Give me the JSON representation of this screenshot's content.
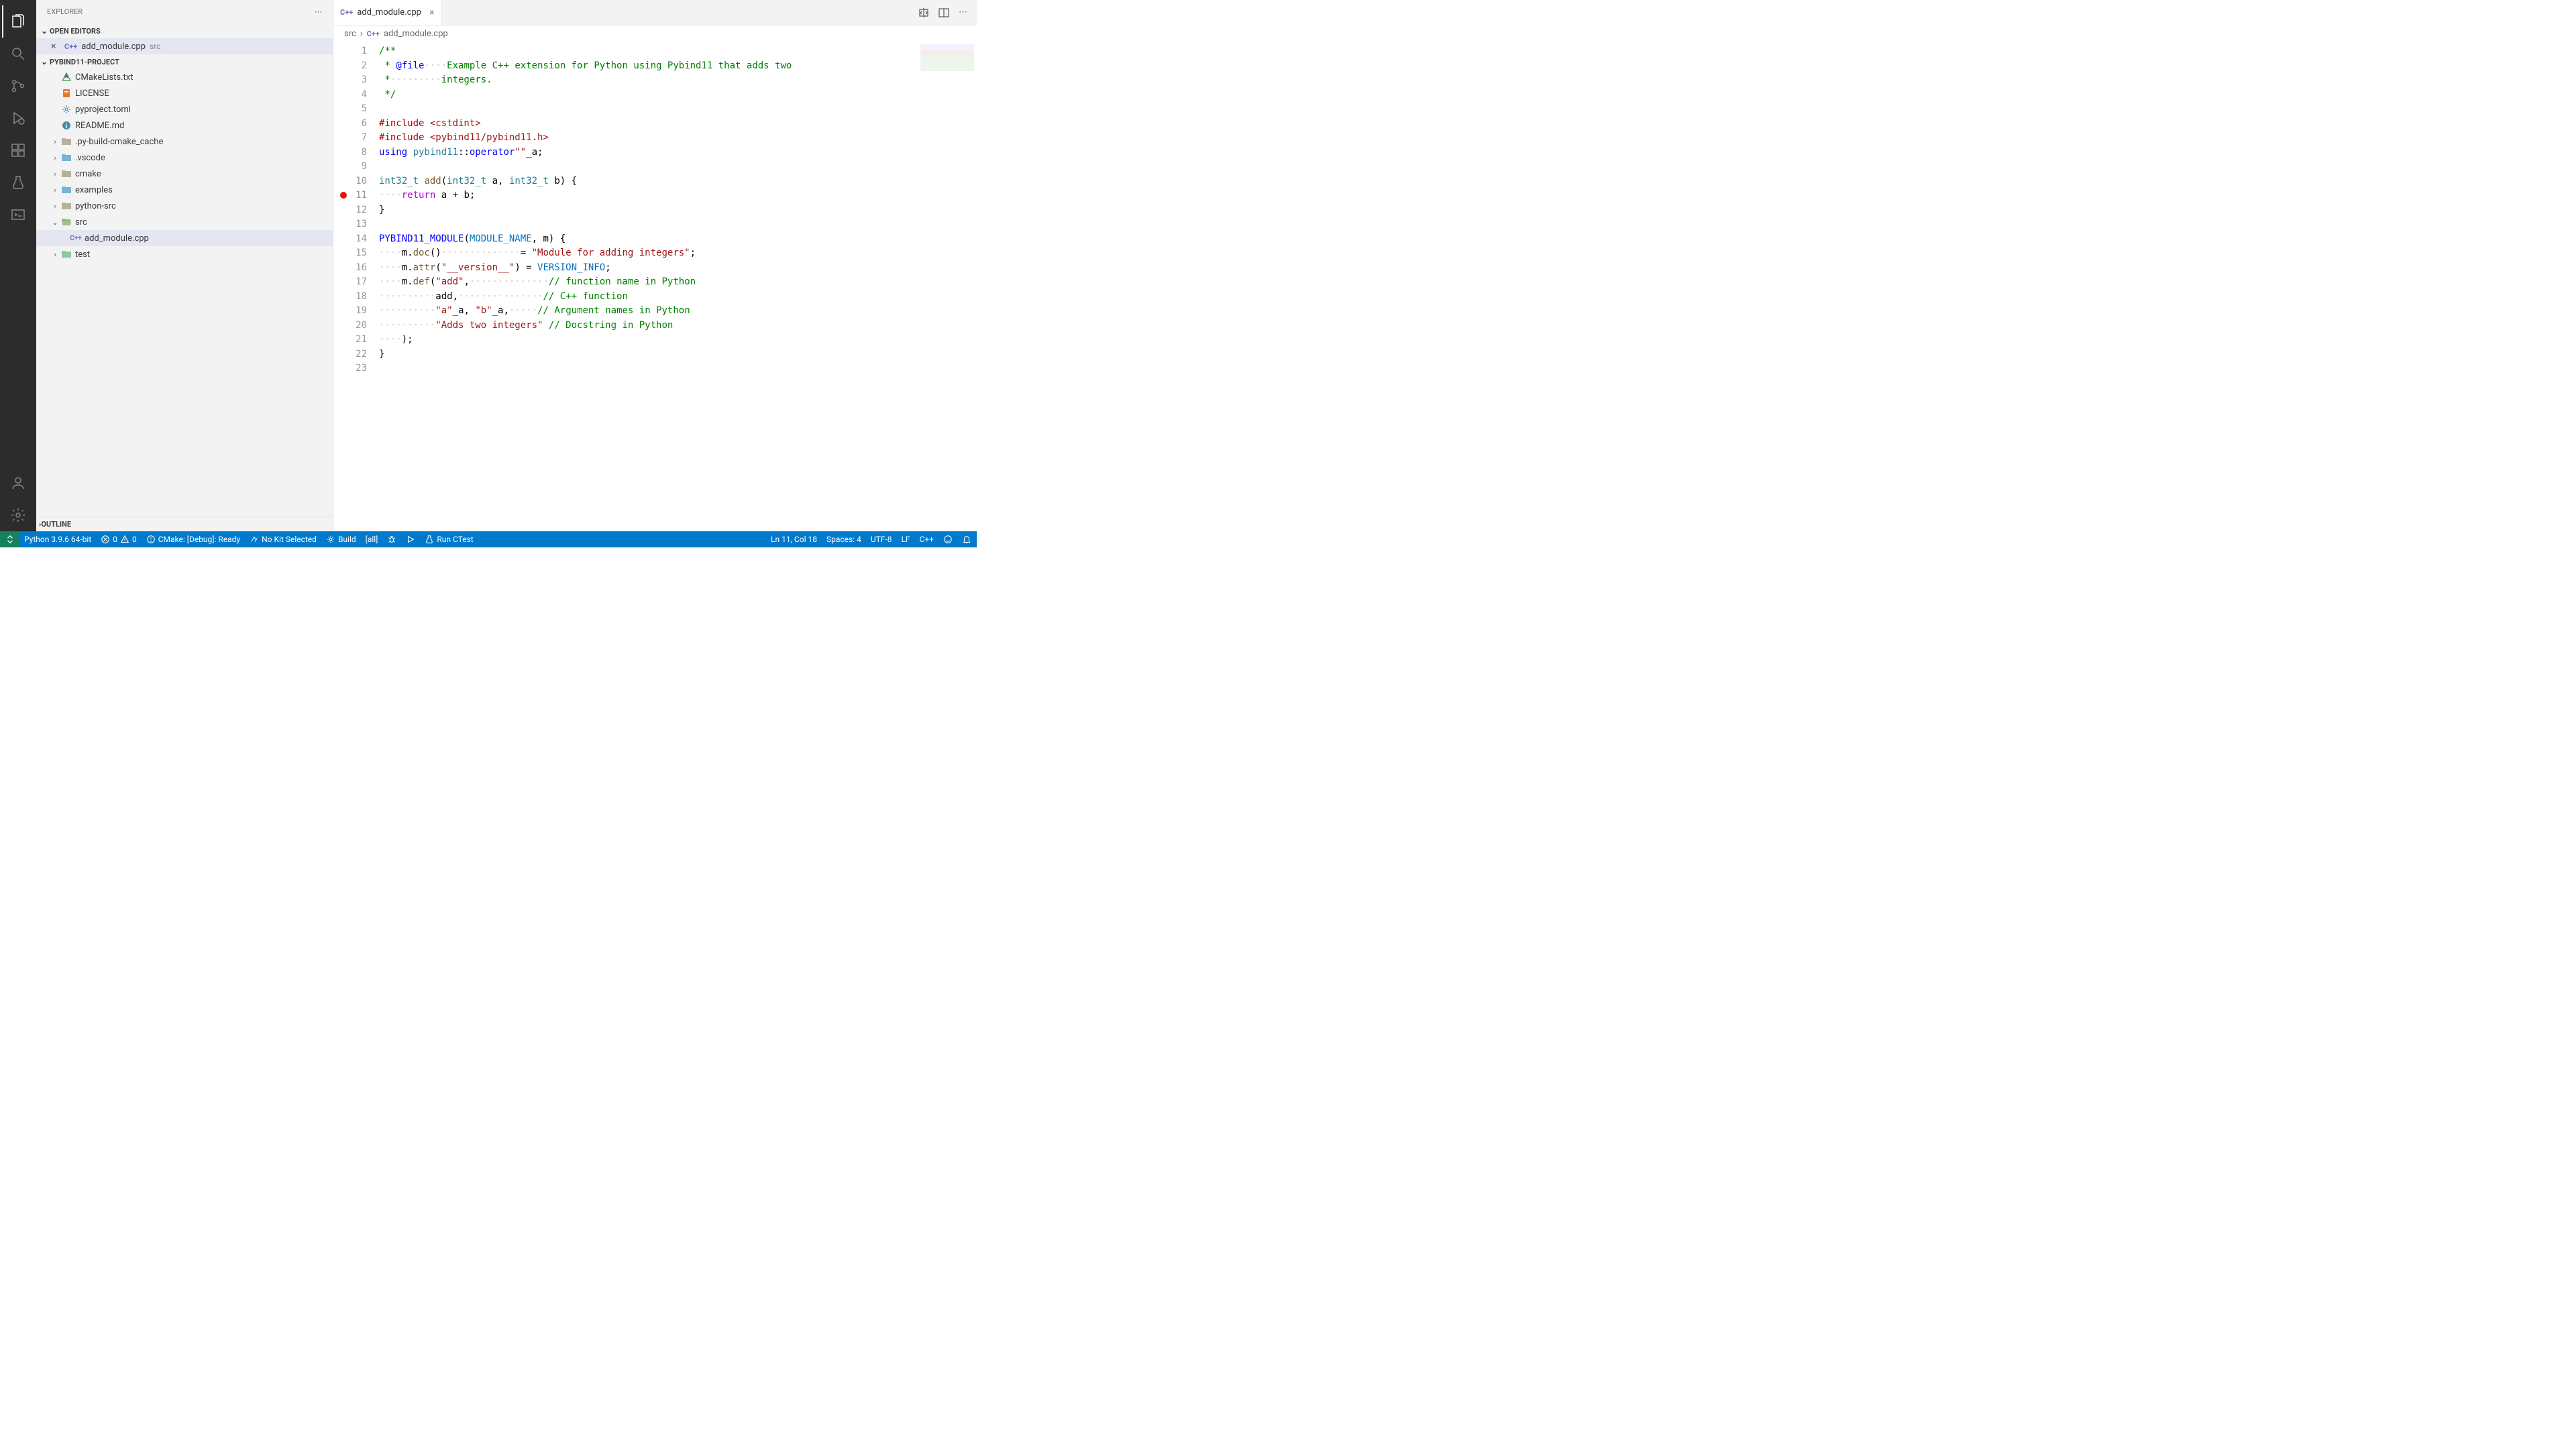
{
  "sidebar": {
    "title": "EXPLORER",
    "openEditors": {
      "title": "OPEN EDITORS",
      "items": [
        {
          "lang": "C++",
          "name": "add_module.cpp",
          "dir": "src"
        }
      ]
    },
    "project": {
      "title": "PYBIND11-PROJECT",
      "tree": [
        {
          "depth": 0,
          "kind": "file",
          "icon": "cmake",
          "name": "CMakeLists.txt"
        },
        {
          "depth": 0,
          "kind": "file",
          "icon": "license",
          "name": "LICENSE"
        },
        {
          "depth": 0,
          "kind": "file",
          "icon": "gear",
          "name": "pyproject.toml"
        },
        {
          "depth": 0,
          "kind": "file",
          "icon": "info",
          "name": "README.md"
        },
        {
          "depth": 0,
          "kind": "folder-closed",
          "name": ".py-build-cmake_cache"
        },
        {
          "depth": 0,
          "kind": "folder-closed-blue",
          "name": ".vscode"
        },
        {
          "depth": 0,
          "kind": "folder-closed",
          "name": "cmake"
        },
        {
          "depth": 0,
          "kind": "folder-closed-blue",
          "name": "examples"
        },
        {
          "depth": 0,
          "kind": "folder-closed",
          "name": "python-src"
        },
        {
          "depth": 0,
          "kind": "folder-open",
          "name": "src",
          "expanded": true
        },
        {
          "depth": 1,
          "kind": "file",
          "icon": "cpp",
          "name": "add_module.cpp",
          "selected": true
        },
        {
          "depth": 0,
          "kind": "folder-closed-green",
          "name": "test"
        }
      ]
    },
    "outline": {
      "title": "OUTLINE"
    }
  },
  "tabs": [
    {
      "lang": "C++",
      "name": "add_module.cpp"
    }
  ],
  "breadcrumb": {
    "parts": [
      {
        "text": "src"
      },
      {
        "lang": "C++",
        "text": "add_module.cpp"
      }
    ]
  },
  "editor": {
    "breakpointLine": 11,
    "currentLine": 11,
    "lines": [
      [
        [
          "comment",
          "/**"
        ]
      ],
      [
        [
          "comment",
          " * "
        ],
        [
          "doctag",
          "@file"
        ],
        [
          "ws",
          "····"
        ],
        [
          "comment",
          "Example C++ extension for Python using Pybind11 that adds two"
        ]
      ],
      [
        [
          "comment",
          " *"
        ],
        [
          "ws",
          "·········"
        ],
        [
          "comment",
          "integers."
        ]
      ],
      [
        [
          "comment",
          " */"
        ]
      ],
      [],
      [
        [
          "preproc",
          "#include "
        ],
        [
          "string",
          "<cstdint>"
        ]
      ],
      [
        [
          "preproc",
          "#include "
        ],
        [
          "string",
          "<pybind11/pybind11.h>"
        ]
      ],
      [
        [
          "keyword",
          "using "
        ],
        [
          "ns",
          "pybind11"
        ],
        [
          "plain",
          "::"
        ],
        [
          "keyword",
          "operator"
        ],
        [
          "string",
          "\"\""
        ],
        [
          "plain",
          "_a;"
        ]
      ],
      [],
      [
        [
          "type",
          "int32_t "
        ],
        [
          "func",
          "add"
        ],
        [
          "plain",
          "("
        ],
        [
          "type",
          "int32_t "
        ],
        [
          "plain",
          "a, "
        ],
        [
          "type",
          "int32_t "
        ],
        [
          "plain",
          "b) {"
        ]
      ],
      [
        [
          "ws",
          "····"
        ],
        [
          "ctrl",
          "return"
        ],
        [
          "plain",
          " a + b;"
        ]
      ],
      [
        [
          "plain",
          "}"
        ]
      ],
      [],
      [
        [
          "macro",
          "PYBIND11_MODULE"
        ],
        [
          "plain",
          "("
        ],
        [
          "const",
          "MODULE_NAME"
        ],
        [
          "plain",
          ", m) {"
        ]
      ],
      [
        [
          "ws",
          "····"
        ],
        [
          "plain",
          "m."
        ],
        [
          "func",
          "doc"
        ],
        [
          "plain",
          "()"
        ],
        [
          "ws",
          "··············"
        ],
        [
          "plain",
          "= "
        ],
        [
          "string",
          "\"Module for adding integers\""
        ],
        [
          "plain",
          ";"
        ]
      ],
      [
        [
          "ws",
          "····"
        ],
        [
          "plain",
          "m."
        ],
        [
          "func",
          "attr"
        ],
        [
          "plain",
          "("
        ],
        [
          "string",
          "\"__version__\""
        ],
        [
          "plain",
          ") = "
        ],
        [
          "const",
          "VERSION_INFO"
        ],
        [
          "plain",
          ";"
        ]
      ],
      [
        [
          "ws",
          "····"
        ],
        [
          "plain",
          "m."
        ],
        [
          "func",
          "def"
        ],
        [
          "plain",
          "("
        ],
        [
          "string",
          "\"add\""
        ],
        [
          "plain",
          ","
        ],
        [
          "ws",
          "··············"
        ],
        [
          "comment",
          "// function name in Python"
        ]
      ],
      [
        [
          "ws",
          "··········"
        ],
        [
          "plain",
          "add,"
        ],
        [
          "ws",
          "···············"
        ],
        [
          "comment",
          "// C++ function"
        ]
      ],
      [
        [
          "ws",
          "··········"
        ],
        [
          "string",
          "\"a\""
        ],
        [
          "plain",
          "_a, "
        ],
        [
          "string",
          "\"b\""
        ],
        [
          "plain",
          "_a,"
        ],
        [
          "ws",
          "·····"
        ],
        [
          "comment",
          "// Argument names in Python"
        ]
      ],
      [
        [
          "ws",
          "··········"
        ],
        [
          "string",
          "\"Adds two integers\""
        ],
        [
          "plain",
          " "
        ],
        [
          "comment",
          "// Docstring in Python"
        ]
      ],
      [
        [
          "ws",
          "····"
        ],
        [
          "plain",
          ");"
        ]
      ],
      [
        [
          "plain",
          "}"
        ]
      ],
      []
    ]
  },
  "statusBar": {
    "python": "Python 3.9.6 64-bit",
    "errors": "0",
    "warnings": "0",
    "cmake": "CMake: [Debug]: Ready",
    "kit": "No Kit Selected",
    "build": "Build",
    "target": "[all]",
    "ctest": "Run CTest",
    "position": "Ln 11, Col 18",
    "spaces": "Spaces: 4",
    "encoding": "UTF-8",
    "eol": "LF",
    "lang": "C++"
  }
}
